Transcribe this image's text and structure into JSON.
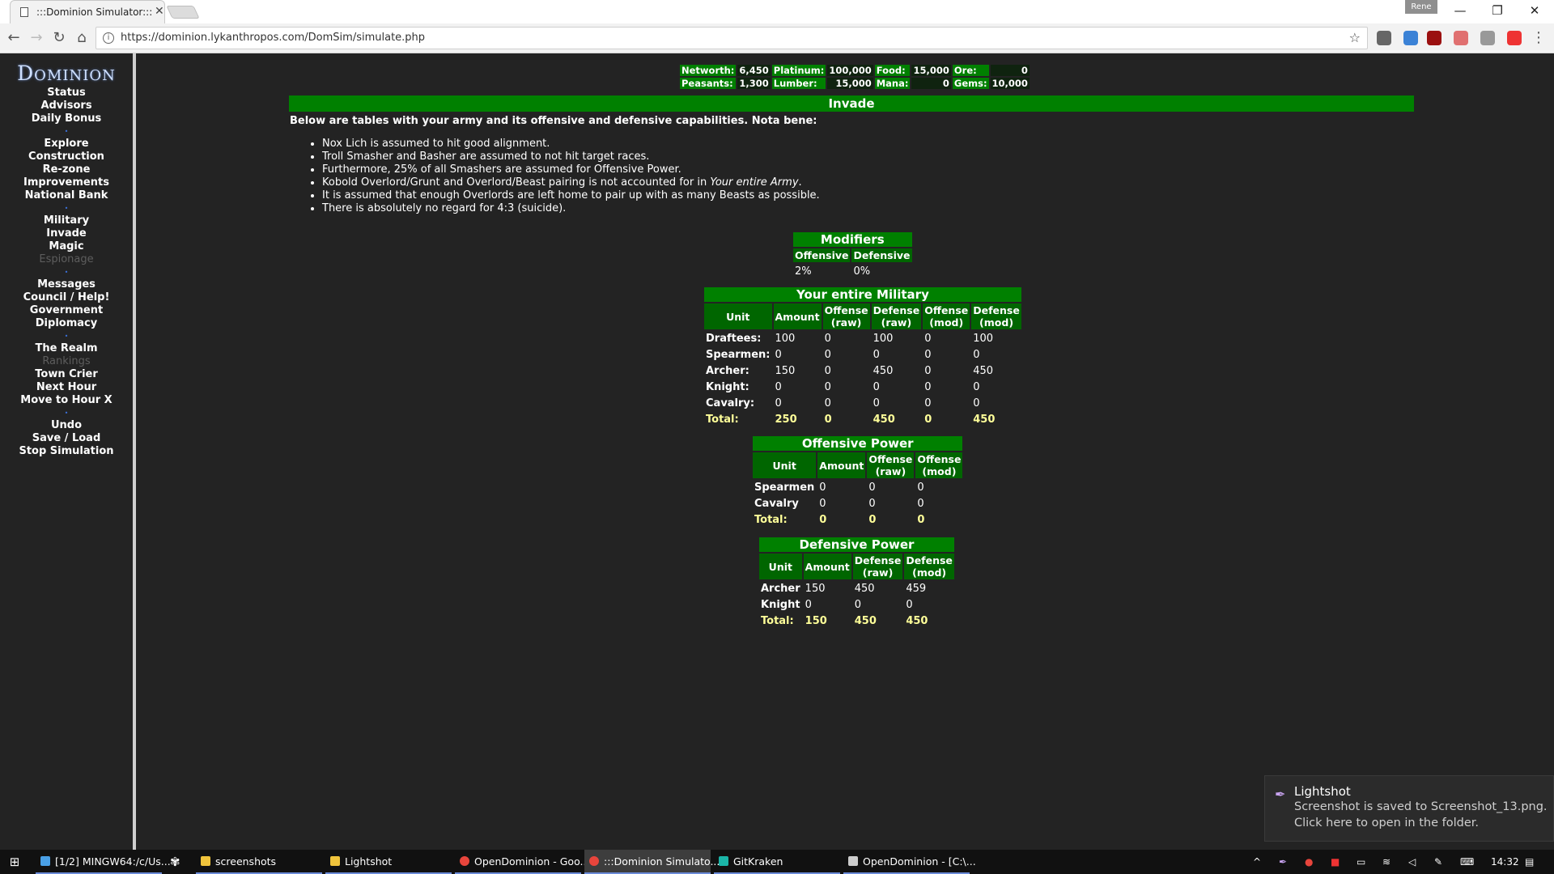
{
  "browser": {
    "tab_title": ":::Dominion Simulator:::",
    "tab_close": "✕",
    "profile": "Rene",
    "url": "https://dominion.lykanthropos.com/DomSim/simulate.php",
    "window_min": "—",
    "window_restore": "❐",
    "window_close": "✕",
    "back": "←",
    "forward": "→",
    "reload": "↻",
    "home": "⌂",
    "star": "☆",
    "menu": "⋮"
  },
  "sidebar": {
    "logo": "Dominion",
    "sep": "•",
    "groups": [
      [
        "Status",
        "Advisors",
        "Daily Bonus"
      ],
      [
        "Explore",
        "Construction",
        "Re-zone",
        "Improvements",
        "National Bank"
      ],
      [
        "Military",
        "Invade",
        "Magic",
        "Espionage"
      ],
      [
        "Messages",
        "Council / Help!",
        "Government",
        "Diplomacy"
      ],
      [
        "The Realm",
        "Rankings",
        "Town Crier",
        "Next Hour",
        "Move to Hour X"
      ],
      [
        "Undo",
        "Save / Load",
        "Stop Simulation"
      ]
    ]
  },
  "resources": {
    "networth_label": "Networth:",
    "networth": "6,450",
    "platinum_label": "Platinum:",
    "platinum": "100,000",
    "food_label": "Food:",
    "food": "15,000",
    "ore_label": "Ore:",
    "ore": "0",
    "peasants_label": "Peasants:",
    "peasants": "1,300",
    "lumber_label": "Lumber:",
    "lumber": "15,000",
    "mana_label": "Mana:",
    "mana": "0",
    "gems_label": "Gems:",
    "gems": "10,000"
  },
  "invade": {
    "title": "Invade",
    "intro": "Below are tables with your army and its offensive and defensive capabilities. Nota bene:",
    "notes": [
      "Nox Lich is assumed to hit good alignment.",
      "Troll Smasher and Basher are assumed to not hit target races.",
      "Furthermore, 25% of all Smashers are assumed for Offensive Power.",
      "Kobold Overlord/Grunt and Overlord/Beast pairing is not accounted for in ",
      "It is assumed that enough Overlords are left home to pair up with as many Beasts as possible.",
      "There is absolutely no regard for 4:3 (suicide)."
    ],
    "note4_italic": "Your entire Army",
    "note4_end": "."
  },
  "modifiers": {
    "title": "Modifiers",
    "headers": [
      "Offensive",
      "Defensive"
    ],
    "values": [
      "2%",
      "0%"
    ]
  },
  "military": {
    "title": "Your entire Military",
    "headers": [
      "Unit",
      "Amount",
      "Offense (raw)",
      "Defense (raw)",
      "Offense (mod)",
      "Defense (mod)"
    ],
    "rows": [
      [
        "Draftees:",
        "100",
        "0",
        "100",
        "0",
        "100"
      ],
      [
        "Spearmen:",
        "0",
        "0",
        "0",
        "0",
        "0"
      ],
      [
        "Archer:",
        "150",
        "0",
        "450",
        "0",
        "450"
      ],
      [
        "Knight:",
        "0",
        "0",
        "0",
        "0",
        "0"
      ],
      [
        "Cavalry:",
        "0",
        "0",
        "0",
        "0",
        "0"
      ]
    ],
    "total": [
      "Total:",
      "250",
      "0",
      "450",
      "0",
      "450"
    ]
  },
  "offensive": {
    "title": "Offensive Power",
    "headers": [
      "Unit",
      "Amount",
      "Offense (raw)",
      "Offense (mod)"
    ],
    "rows": [
      [
        "Spearmen",
        "0",
        "0",
        "0"
      ],
      [
        "Cavalry",
        "0",
        "0",
        "0"
      ]
    ],
    "total": [
      "Total:",
      "0",
      "0",
      "0"
    ]
  },
  "defensive": {
    "title": "Defensive Power",
    "headers": [
      "Unit",
      "Amount",
      "Defense (raw)",
      "Defense (mod)"
    ],
    "rows": [
      [
        "Archer",
        "150",
        "450",
        "459"
      ],
      [
        "Knight",
        "0",
        "0",
        "0"
      ]
    ],
    "total": [
      "Total:",
      "150",
      "450",
      "450"
    ]
  },
  "toast": {
    "title": "Lightshot",
    "line1": "Screenshot is saved to Screenshot_13.png.",
    "line2": "Click here to open in the folder."
  },
  "taskbar": {
    "start": "⊞",
    "items": [
      {
        "label": "[1/2] MINGW64:/c/Us...",
        "color": "#4aa0e6"
      },
      {
        "label": "screenshots",
        "color": "#f0c43c"
      },
      {
        "label": "Lightshot",
        "color": "#f0c43c"
      },
      {
        "label": "OpenDominion - Goo...",
        "color": "#e8453c"
      },
      {
        "label": ":::Dominion Simulato...",
        "color": "#e8453c"
      },
      {
        "label": "GitKraken",
        "color": "#1bb5a8"
      },
      {
        "label": "OpenDominion - [C:\\...",
        "color": "#cccccc"
      }
    ],
    "clock": "14:32"
  }
}
